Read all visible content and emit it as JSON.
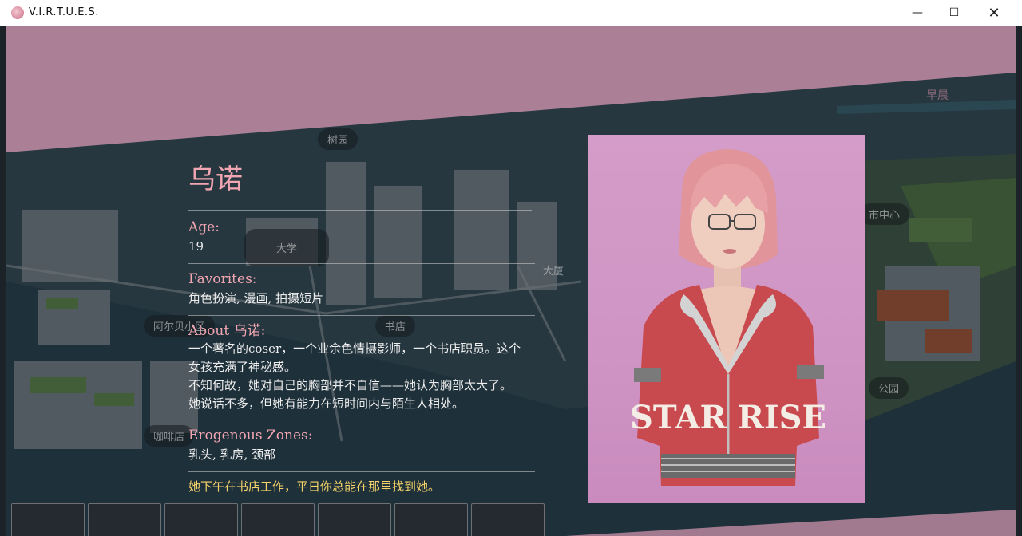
{
  "window": {
    "title": "V.I.R.T.U.E.S.",
    "minimize_glyph": "—",
    "maximize_glyph": "☐",
    "close_glyph": "✕"
  },
  "map_labels": {
    "top_right": "早晨",
    "label_a": "树园",
    "label_b": "大学",
    "label_c": "大厦",
    "label_d": "市中心",
    "label_e": "公园",
    "label_f": "咖啡店",
    "label_g": "书店",
    "label_h": "阿尔贝小区"
  },
  "character": {
    "name": "乌诺",
    "age_label": "Age:",
    "age_value": "19",
    "favorites_label": "Favorites:",
    "favorites_value": "角色扮演, 漫画, 拍摄短片",
    "about_label": "About 乌诺:",
    "about_lines": [
      "一个著名的coser，一个业余色情摄影师，一个书店职员。这个",
      "女孩充满了神秘感。",
      "不知何故，她对自己的胸部并不自信——她认为胸部太大了。",
      "她说话不多，但她有能力在短时间内与陌生人相处。"
    ],
    "erogenous_label": "Erogenous Zones:",
    "erogenous_value": "乳头, 乳房, 颈部",
    "location_hint": "她下午在书店工作，平日你总能在那里找到她。",
    "portrait_shirt_text": "STAR RISE"
  },
  "colors": {
    "accent_pink": "#f2a6b2",
    "hint_yellow": "#f5d36a",
    "band_mauve": "#b3869c",
    "portrait_bg": "#d49cc8"
  }
}
